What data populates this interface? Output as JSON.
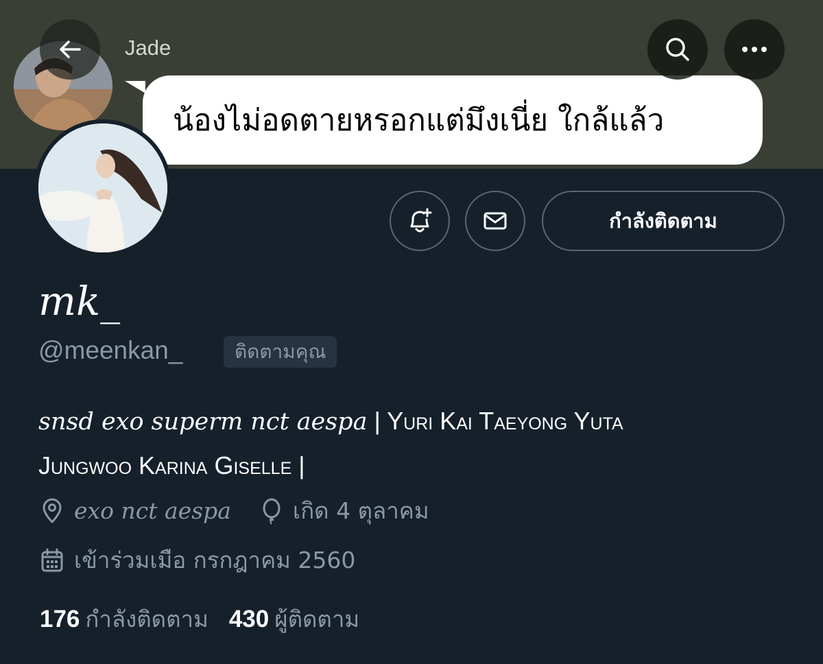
{
  "banner": {
    "chat_name": "Jade",
    "message": "น้องไม่อดตายหรอกแต่มึงเนี่ย ใกล้แล้ว"
  },
  "header": {
    "back_icon": "arrow-left-icon",
    "search_icon": "search-icon",
    "more_icon": "more-icon"
  },
  "actions": {
    "notify_icon": "bell-plus-icon",
    "message_icon": "mail-icon",
    "follow_label": "กำลังติดตาม"
  },
  "profile": {
    "display_name": "mk_",
    "handle": "@meenkan_",
    "follows_you": "ติดตามคุณ",
    "bio_serif": "snsd exo superm nct aespa",
    "bio_caps_line1": " | Yuri Kai Taeyong Yuta",
    "bio_caps_line2": "Jungwoo Karina Giselle |",
    "location": "exo nct aespa",
    "birthday": "เกิด 4 ตุลาคม",
    "joined": "เข้าร่วมเมือ กรกฎาคม 2560"
  },
  "stats": {
    "following_count": "176",
    "following_label": "กำลังติดตาม",
    "followers_count": "430",
    "followers_label": "ผู้ติดตาม"
  },
  "colors": {
    "background": "#15202b",
    "banner": "#3a3f36",
    "muted_text": "#8b98a5",
    "border": "#5b6672"
  }
}
